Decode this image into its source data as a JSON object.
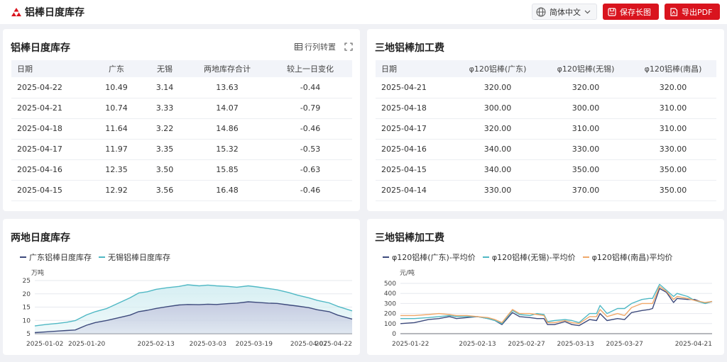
{
  "header": {
    "title": "铝棒日度库存",
    "language": "简体中文",
    "save_image_label": "保存长图",
    "export_pdf_label": "导出PDF",
    "accent_color": "#d9141e"
  },
  "inventory_table": {
    "title": "铝棒日度库存",
    "transpose_label": "行列转置",
    "columns": [
      "日期",
      "广东",
      "无锡",
      "两地库存合计",
      "较上一日变化"
    ],
    "rows": [
      [
        "2025-04-22",
        "10.49",
        "3.14",
        "13.63",
        "-0.44"
      ],
      [
        "2025-04-21",
        "10.74",
        "3.33",
        "14.07",
        "-0.79"
      ],
      [
        "2025-04-18",
        "11.64",
        "3.22",
        "14.86",
        "-0.46"
      ],
      [
        "2025-04-17",
        "11.97",
        "3.35",
        "15.32",
        "-0.53"
      ],
      [
        "2025-04-16",
        "12.35",
        "3.50",
        "15.85",
        "-0.63"
      ],
      [
        "2025-04-15",
        "12.92",
        "3.56",
        "16.48",
        "-0.46"
      ]
    ]
  },
  "fee_table": {
    "title": "三地铝棒加工费",
    "columns": [
      "日期",
      "φ120铝棒(广东)",
      "φ120铝棒(无锡)",
      "φ120铝棒(南昌)"
    ],
    "rows": [
      [
        "2025-04-21",
        "320.00",
        "320.00",
        "320.00"
      ],
      [
        "2025-04-18",
        "300.00",
        "300.00",
        "310.00"
      ],
      [
        "2025-04-17",
        "320.00",
        "310.00",
        "310.00"
      ],
      [
        "2025-04-16",
        "340.00",
        "330.00",
        "330.00"
      ],
      [
        "2025-04-15",
        "340.00",
        "350.00",
        "350.00"
      ],
      [
        "2025-04-14",
        "330.00",
        "370.00",
        "350.00"
      ]
    ]
  },
  "inventory_chart": {
    "title": "两地日度库存",
    "unit": "万吨"
  },
  "fee_chart": {
    "title": "三地铝棒加工费",
    "unit": "元/吨"
  },
  "chart_data": [
    {
      "type": "area",
      "stacked": true,
      "title": "两地日度库存",
      "ylabel": "万吨",
      "ylim": [
        5,
        25
      ],
      "yticks": [
        5,
        10,
        15,
        20,
        25
      ],
      "xlim": [
        "2025-01-02",
        "2025-04-22"
      ],
      "xticks": [
        "2025-01-02",
        "2025-01-20",
        "2025-02-13",
        "2025-03-03",
        "2025-03-19",
        "2025-04-07",
        "2025-04-22"
      ],
      "grid": true,
      "legend": "top-left",
      "series": [
        {
          "name": "广东铝棒日度库存",
          "color": "#3d4a7c",
          "fill": "#c5c9e0",
          "points": [
            [
              "2025-01-02",
              5.4
            ],
            [
              "2025-01-06",
              5.7
            ],
            [
              "2025-01-10",
              6.0
            ],
            [
              "2025-01-13",
              6.2
            ],
            [
              "2025-01-16",
              6.4
            ],
            [
              "2025-01-20",
              8.2
            ],
            [
              "2025-01-23",
              9.2
            ],
            [
              "2025-01-27",
              10.0
            ],
            [
              "2025-02-04",
              12.0
            ],
            [
              "2025-02-07",
              13.3
            ],
            [
              "2025-02-10",
              13.8
            ],
            [
              "2025-02-13",
              14.5
            ],
            [
              "2025-02-17",
              15.2
            ],
            [
              "2025-02-21",
              15.8
            ],
            [
              "2025-02-24",
              16.0
            ],
            [
              "2025-02-28",
              15.9
            ],
            [
              "2025-03-03",
              16.1
            ],
            [
              "2025-03-06",
              16.0
            ],
            [
              "2025-03-10",
              16.3
            ],
            [
              "2025-03-13",
              16.5
            ],
            [
              "2025-03-17",
              17.0
            ],
            [
              "2025-03-20",
              16.8
            ],
            [
              "2025-03-24",
              16.5
            ],
            [
              "2025-03-27",
              16.4
            ],
            [
              "2025-03-31",
              15.8
            ],
            [
              "2025-04-03",
              15.4
            ],
            [
              "2025-04-07",
              14.8
            ],
            [
              "2025-04-10",
              14.0
            ],
            [
              "2025-04-14",
              13.3
            ],
            [
              "2025-04-17",
              12.0
            ],
            [
              "2025-04-22",
              10.5
            ]
          ]
        },
        {
          "name": "无锡铝棒日度库存",
          "color": "#4fb8c4",
          "fill": "#d4eef2",
          "points": [
            [
              "2025-01-02",
              7.9
            ],
            [
              "2025-01-06",
              8.5
            ],
            [
              "2025-01-10",
              8.9
            ],
            [
              "2025-01-13",
              9.3
            ],
            [
              "2025-01-16",
              9.9
            ],
            [
              "2025-01-20",
              12.1
            ],
            [
              "2025-01-23",
              13.3
            ],
            [
              "2025-01-27",
              14.5
            ],
            [
              "2025-02-04",
              18.5
            ],
            [
              "2025-02-07",
              20.3
            ],
            [
              "2025-02-10",
              20.8
            ],
            [
              "2025-02-13",
              21.7
            ],
            [
              "2025-02-17",
              22.3
            ],
            [
              "2025-02-21",
              22.8
            ],
            [
              "2025-02-24",
              23.4
            ],
            [
              "2025-02-28",
              23.0
            ],
            [
              "2025-03-03",
              23.3
            ],
            [
              "2025-03-06",
              23.0
            ],
            [
              "2025-03-10",
              22.8
            ],
            [
              "2025-03-13",
              22.5
            ],
            [
              "2025-03-17",
              23.0
            ],
            [
              "2025-03-20",
              22.6
            ],
            [
              "2025-03-24",
              22.0
            ],
            [
              "2025-03-27",
              21.5
            ],
            [
              "2025-03-31",
              20.5
            ],
            [
              "2025-04-03",
              19.5
            ],
            [
              "2025-04-07",
              18.5
            ],
            [
              "2025-04-10",
              17.5
            ],
            [
              "2025-04-14",
              16.6
            ],
            [
              "2025-04-17",
              15.3
            ],
            [
              "2025-04-22",
              13.6
            ]
          ]
        }
      ]
    },
    {
      "type": "line",
      "title": "三地铝棒加工费",
      "ylabel": "元/吨",
      "ylim": [
        0,
        500
      ],
      "yticks": [
        0,
        100,
        200,
        300,
        400,
        500
      ],
      "xlim": [
        "2025-01-22",
        "2025-04-21"
      ],
      "xticks": [
        "2025-01-22",
        "2025-02-13",
        "2025-02-27",
        "2025-03-13",
        "2025-03-27",
        "2025-04-21"
      ],
      "grid": true,
      "legend": "top-left",
      "series": [
        {
          "name": "φ120铝棒(广东)-平均价",
          "color": "#3d4a7c",
          "points": [
            [
              "2025-01-22",
              100
            ],
            [
              "2025-01-26",
              110
            ],
            [
              "2025-01-30",
              140
            ],
            [
              "2025-02-02",
              150
            ],
            [
              "2025-02-05",
              170
            ],
            [
              "2025-02-07",
              150
            ],
            [
              "2025-02-10",
              160
            ],
            [
              "2025-02-13",
              170
            ],
            [
              "2025-02-16",
              150
            ],
            [
              "2025-02-18",
              130
            ],
            [
              "2025-02-20",
              90
            ],
            [
              "2025-02-23",
              210
            ],
            [
              "2025-02-25",
              170
            ],
            [
              "2025-02-28",
              160
            ],
            [
              "2025-03-02",
              150
            ],
            [
              "2025-03-04",
              150
            ],
            [
              "2025-03-05",
              90
            ],
            [
              "2025-03-07",
              90
            ],
            [
              "2025-03-10",
              120
            ],
            [
              "2025-03-12",
              90
            ],
            [
              "2025-03-14",
              80
            ],
            [
              "2025-03-17",
              140
            ],
            [
              "2025-03-19",
              130
            ],
            [
              "2025-03-20",
              200
            ],
            [
              "2025-03-22",
              130
            ],
            [
              "2025-03-25",
              150
            ],
            [
              "2025-03-27",
              140
            ],
            [
              "2025-03-29",
              210
            ],
            [
              "2025-04-01",
              230
            ],
            [
              "2025-04-03",
              240
            ],
            [
              "2025-04-04",
              250
            ],
            [
              "2025-04-06",
              450
            ],
            [
              "2025-04-08",
              410
            ],
            [
              "2025-04-10",
              310
            ],
            [
              "2025-04-11",
              350
            ],
            [
              "2025-04-14",
              340
            ],
            [
              "2025-04-16",
              340
            ],
            [
              "2025-04-19",
              300
            ],
            [
              "2025-04-21",
              320
            ]
          ]
        },
        {
          "name": "φ120铝棒(无锡)-平均价",
          "color": "#4fb8c4",
          "points": [
            [
              "2025-01-22",
              150
            ],
            [
              "2025-01-26",
              150
            ],
            [
              "2025-01-30",
              160
            ],
            [
              "2025-02-02",
              170
            ],
            [
              "2025-02-05",
              180
            ],
            [
              "2025-02-07",
              170
            ],
            [
              "2025-02-10",
              170
            ],
            [
              "2025-02-13",
              170
            ],
            [
              "2025-02-16",
              150
            ],
            [
              "2025-02-18",
              130
            ],
            [
              "2025-02-20",
              100
            ],
            [
              "2025-02-23",
              230
            ],
            [
              "2025-02-25",
              190
            ],
            [
              "2025-02-28",
              180
            ],
            [
              "2025-03-02",
              200
            ],
            [
              "2025-03-04",
              190
            ],
            [
              "2025-03-05",
              120
            ],
            [
              "2025-03-07",
              130
            ],
            [
              "2025-03-10",
              140
            ],
            [
              "2025-03-12",
              130
            ],
            [
              "2025-03-14",
              110
            ],
            [
              "2025-03-17",
              200
            ],
            [
              "2025-03-19",
              200
            ],
            [
              "2025-03-20",
              280
            ],
            [
              "2025-03-22",
              200
            ],
            [
              "2025-03-25",
              250
            ],
            [
              "2025-03-27",
              250
            ],
            [
              "2025-03-29",
              300
            ],
            [
              "2025-04-01",
              340
            ],
            [
              "2025-04-03",
              350
            ],
            [
              "2025-04-04",
              350
            ],
            [
              "2025-04-06",
              490
            ],
            [
              "2025-04-08",
              430
            ],
            [
              "2025-04-10",
              370
            ],
            [
              "2025-04-11",
              400
            ],
            [
              "2025-04-14",
              370
            ],
            [
              "2025-04-16",
              330
            ],
            [
              "2025-04-19",
              300
            ],
            [
              "2025-04-21",
              320
            ]
          ]
        },
        {
          "name": "φ120铝棒(南昌)平均价",
          "color": "#f0a86a",
          "points": [
            [
              "2025-01-22",
              180
            ],
            [
              "2025-01-26",
              180
            ],
            [
              "2025-01-30",
              190
            ],
            [
              "2025-02-02",
              200
            ],
            [
              "2025-02-05",
              190
            ],
            [
              "2025-02-07",
              180
            ],
            [
              "2025-02-10",
              180
            ],
            [
              "2025-02-13",
              170
            ],
            [
              "2025-02-16",
              160
            ],
            [
              "2025-02-18",
              140
            ],
            [
              "2025-02-20",
              110
            ],
            [
              "2025-02-23",
              240
            ],
            [
              "2025-02-25",
              200
            ],
            [
              "2025-02-28",
              200
            ],
            [
              "2025-03-02",
              190
            ],
            [
              "2025-03-04",
              180
            ],
            [
              "2025-03-05",
              110
            ],
            [
              "2025-03-07",
              110
            ],
            [
              "2025-03-10",
              130
            ],
            [
              "2025-03-12",
              110
            ],
            [
              "2025-03-14",
              100
            ],
            [
              "2025-03-17",
              170
            ],
            [
              "2025-03-19",
              170
            ],
            [
              "2025-03-20",
              240
            ],
            [
              "2025-03-22",
              170
            ],
            [
              "2025-03-25",
              200
            ],
            [
              "2025-03-27",
              180
            ],
            [
              "2025-03-29",
              260
            ],
            [
              "2025-04-01",
              300
            ],
            [
              "2025-04-03",
              300
            ],
            [
              "2025-04-04",
              300
            ],
            [
              "2025-04-06",
              470
            ],
            [
              "2025-04-08",
              420
            ],
            [
              "2025-04-10",
              340
            ],
            [
              "2025-04-11",
              370
            ],
            [
              "2025-04-14",
              350
            ],
            [
              "2025-04-16",
              330
            ],
            [
              "2025-04-19",
              310
            ],
            [
              "2025-04-21",
              320
            ]
          ]
        }
      ]
    }
  ]
}
